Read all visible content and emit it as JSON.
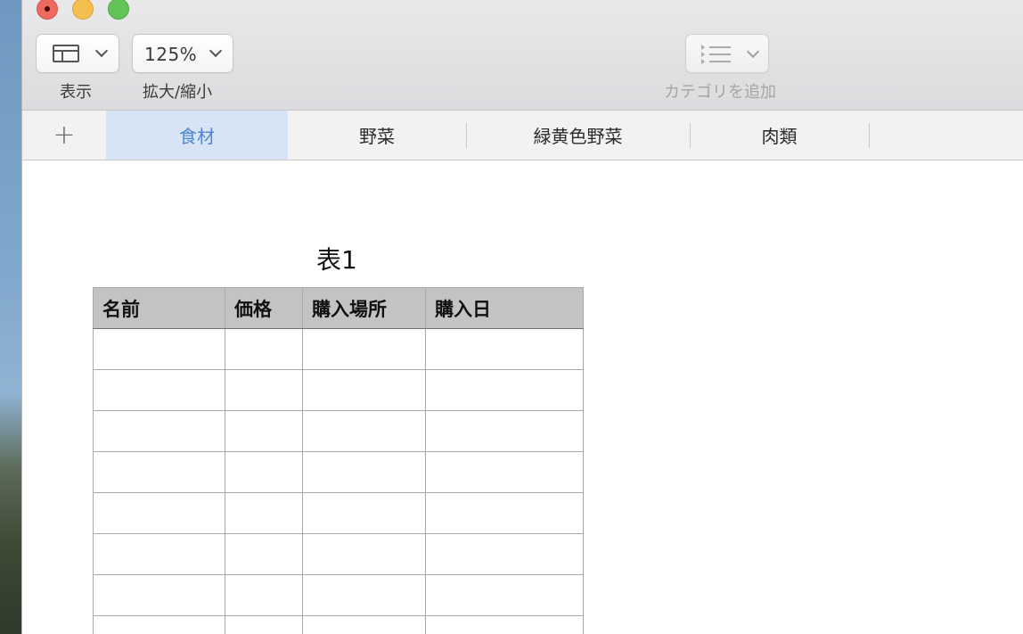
{
  "toolbar": {
    "view_label": "表示",
    "zoom_value": "125%",
    "zoom_label": "拡大/縮小",
    "category_label": "カテゴリを追加",
    "icons": {
      "view": "sidebar-layout-icon",
      "view_chevron": "chevron-down-icon",
      "zoom_chevron": "chevron-down-icon",
      "category": "list-icon",
      "category_chevron": "chevron-down-icon"
    }
  },
  "tabbar": {
    "add_symbol": "+",
    "tabs": [
      {
        "label": "食材",
        "active": true
      },
      {
        "label": "野菜",
        "active": false
      },
      {
        "label": "緑黄色野菜",
        "active": false
      },
      {
        "label": "肉類",
        "active": false
      }
    ]
  },
  "sheet": {
    "table_title": "表1",
    "columns": [
      "名前",
      "価格",
      "購入場所",
      "購入日"
    ],
    "rows": [
      [
        "",
        "",
        "",
        ""
      ],
      [
        "",
        "",
        "",
        ""
      ],
      [
        "",
        "",
        "",
        ""
      ],
      [
        "",
        "",
        "",
        ""
      ],
      [
        "",
        "",
        "",
        ""
      ],
      [
        "",
        "",
        "",
        ""
      ],
      [
        "",
        "",
        "",
        ""
      ],
      [
        "",
        "",
        "",
        ""
      ]
    ]
  },
  "colors": {
    "accent": "#4f86d3",
    "active_tab_bg": "#d7e4f5",
    "header_bg": "#c2c3c4"
  }
}
